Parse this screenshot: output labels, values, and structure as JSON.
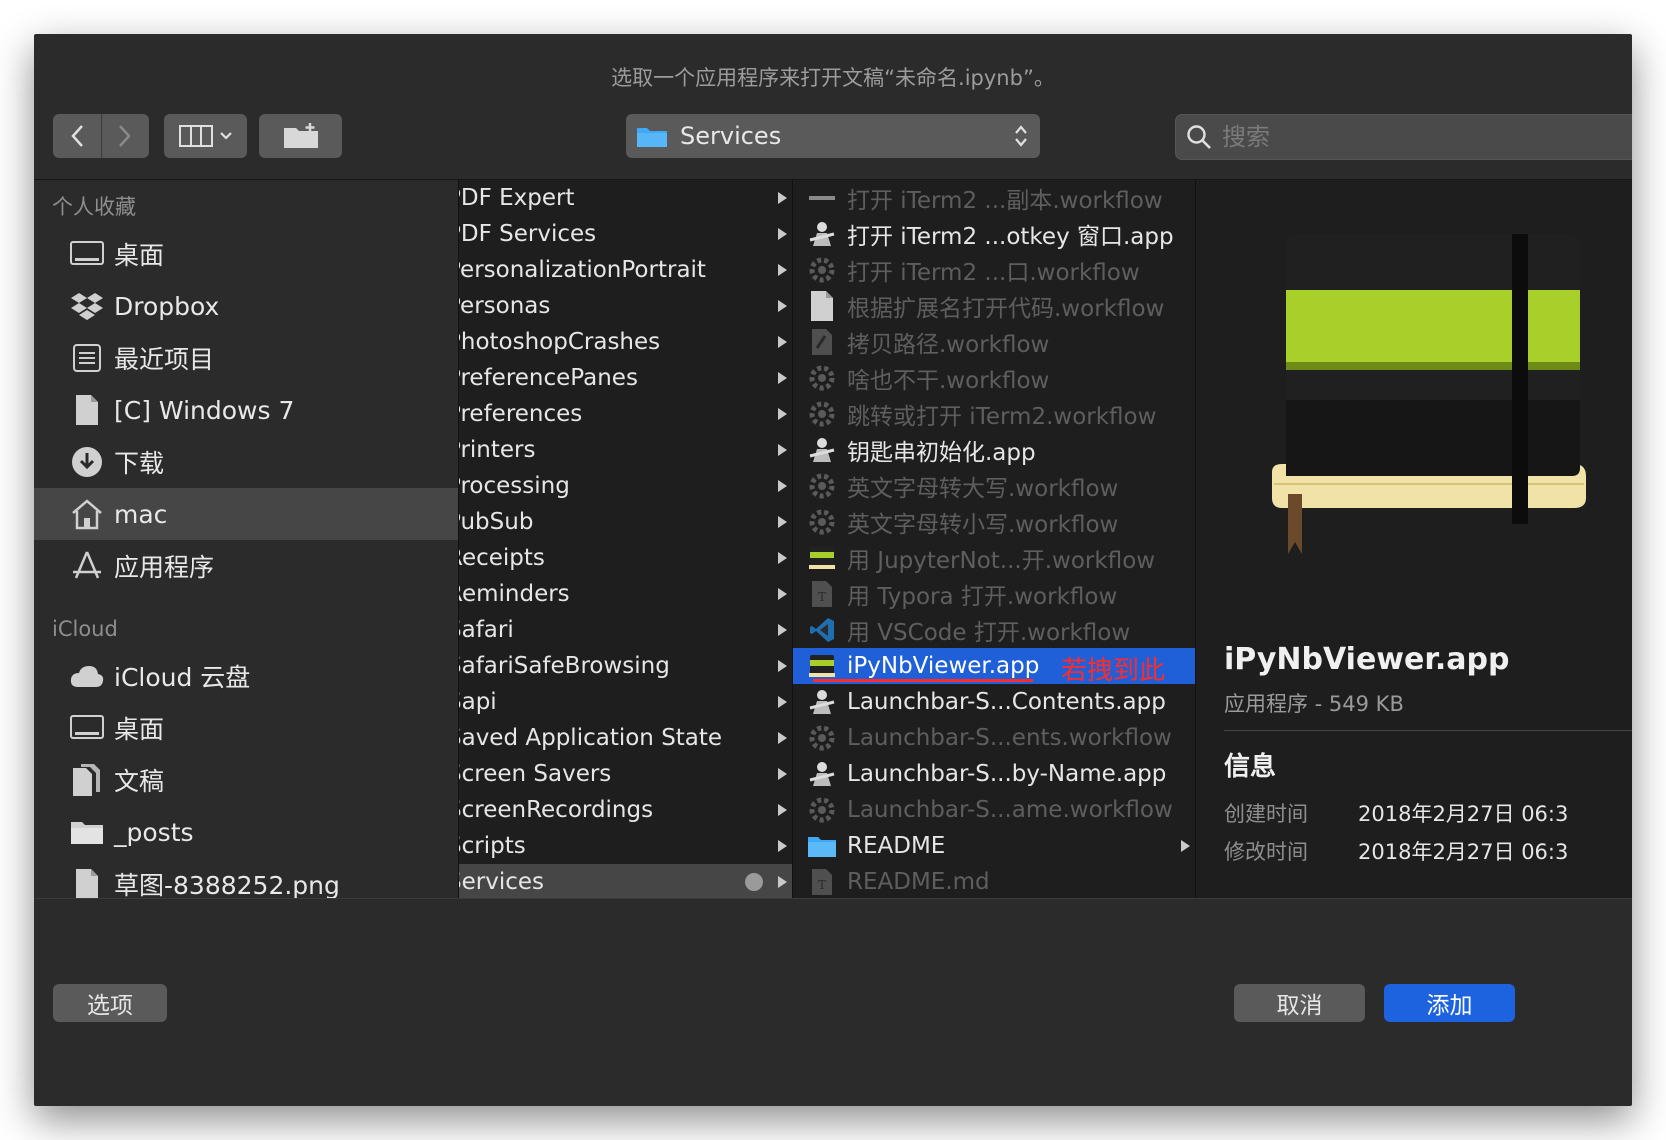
{
  "dialog": {
    "title": "选取一个应用程序来打开文稿“未命名.ipynb”。"
  },
  "toolbar": {
    "location": "Services",
    "search_placeholder": "搜索"
  },
  "sidebar": {
    "sections": [
      {
        "header": "个人收藏",
        "items": [
          {
            "label": "桌面",
            "icon": "desktop-icon"
          },
          {
            "label": "Dropbox",
            "icon": "dropbox-icon"
          },
          {
            "label": "最近项目",
            "icon": "recents-icon"
          },
          {
            "label": "[C] Windows 7",
            "icon": "document-icon"
          },
          {
            "label": "下载",
            "icon": "download-icon"
          },
          {
            "label": "mac",
            "icon": "home-icon",
            "selected": true
          },
          {
            "label": "应用程序",
            "icon": "applications-icon"
          }
        ]
      },
      {
        "header": "iCloud",
        "items": [
          {
            "label": "iCloud 云盘",
            "icon": "cloud-icon"
          },
          {
            "label": "桌面",
            "icon": "desktop-icon"
          },
          {
            "label": "文稿",
            "icon": "documents-icon"
          },
          {
            "label": "_posts",
            "icon": "folder-icon"
          },
          {
            "label": "草图-8388252.png",
            "icon": "document-icon"
          }
        ]
      }
    ]
  },
  "column1": [
    "PDF Expert",
    "PDF Services",
    "PersonalizationPortrait",
    "Personas",
    "PhotoshopCrashes",
    "PreferencePanes",
    "Preferences",
    "Printers",
    "Processing",
    "PubSub",
    "Receipts",
    "Reminders",
    "Safari",
    "SafariSafeBrowsing",
    "Sapi",
    "Saved Application State",
    "Screen Savers",
    "ScreenRecordings",
    "Scripts",
    "Services"
  ],
  "column1_selected": "Services",
  "column2": [
    {
      "label": "打开 iTerm2 ...副本.workflow",
      "icon": "bar-icon",
      "dim": true
    },
    {
      "label": "打开 iTerm2 ...otkey 窗口.app",
      "icon": "automator-icon",
      "dim": false
    },
    {
      "label": "打开 iTerm2 ...口.workflow",
      "icon": "workflow-icon",
      "dim": true
    },
    {
      "label": "根据扩展名打开代码.workflow",
      "icon": "document-icon",
      "dim": true
    },
    {
      "label": "拷贝路径.workflow",
      "icon": "script-icon",
      "dim": true
    },
    {
      "label": "啥也不干.workflow",
      "icon": "workflow-icon",
      "dim": true
    },
    {
      "label": "跳转或打开 iTerm2.workflow",
      "icon": "workflow-icon",
      "dim": true
    },
    {
      "label": "钥匙串初始化.app",
      "icon": "automator-icon",
      "dim": false
    },
    {
      "label": "英文字母转大写.workflow",
      "icon": "workflow-icon",
      "dim": true
    },
    {
      "label": "英文字母转小写.workflow",
      "icon": "workflow-icon",
      "dim": true
    },
    {
      "label": "用 JupyterNot...开.workflow",
      "icon": "notebook-icon",
      "dim": true
    },
    {
      "label": "用 Typora 打开.workflow",
      "icon": "typora-icon",
      "dim": true
    },
    {
      "label": "用 VSCode 打开.workflow",
      "icon": "vscode-icon",
      "dim": true
    },
    {
      "label": "iPyNbViewer.app",
      "icon": "notebook-icon",
      "dim": false,
      "selected": true
    },
    {
      "label": "Launchbar-S...Contents.app",
      "icon": "automator-icon",
      "dim": false
    },
    {
      "label": "Launchbar-S...ents.workflow",
      "icon": "workflow-icon",
      "dim": true
    },
    {
      "label": "Launchbar-S...by-Name.app",
      "icon": "automator-icon",
      "dim": false
    },
    {
      "label": "Launchbar-S...ame.workflow",
      "icon": "workflow-icon",
      "dim": true
    },
    {
      "label": "README",
      "icon": "folder-icon",
      "dim": false,
      "folder": true
    },
    {
      "label": "README.md",
      "icon": "typora-icon",
      "dim": true
    }
  ],
  "annotation": "若拽到此",
  "preview": {
    "name": "iPyNbViewer.app",
    "kind_size": "应用程序 - 549 KB",
    "info_header": "信息",
    "rows": [
      {
        "key": "创建时间",
        "value": "2018年2月27日 06:3"
      },
      {
        "key": "修改时间",
        "value": "2018年2月27日 06:3"
      }
    ]
  },
  "footer": {
    "options": "选项",
    "cancel": "取消",
    "add": "添加"
  },
  "colors": {
    "accent": "#1f5fd8",
    "annotation": "#ff2b2b",
    "folder": "#3fa9f5"
  }
}
